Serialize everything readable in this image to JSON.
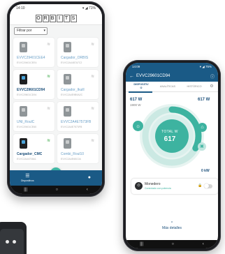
{
  "phone1": {
    "status": {
      "time": "14:10",
      "icons": "▾ ◢ 71%"
    },
    "logo_letters": [
      "O",
      "R",
      "B",
      "I",
      "T",
      "S"
    ],
    "filter": {
      "label": "Filtrar por",
      "chevron": "▾"
    },
    "devices": [
      {
        "name": "EVVC29401CEE4",
        "code": "EVVC29401CEE4",
        "wifi_on": false,
        "dark": false,
        "bold": false
      },
      {
        "name": "Cargador_ORBIS",
        "code": "EVVC2A4487A7C2",
        "wifi_on": false,
        "dark": false,
        "bold": false
      },
      {
        "name": "EVVC29601CD94",
        "code": "EVVC29601CD94",
        "wifi_on": true,
        "dark": true,
        "bold": true
      },
      {
        "name": "Cargador_Ikuill",
        "code": "EVVC2A4E9B9A2C",
        "wifi_on": false,
        "dark": false,
        "bold": false
      },
      {
        "name": "UNI_RoulC",
        "code": "EVVC29401CE60",
        "wifi_on": false,
        "dark": false,
        "bold": false
      },
      {
        "name": "EVVC2A4E7573FB",
        "code": "EVVC2A4E7573FB",
        "wifi_on": false,
        "dark": false,
        "bold": false
      },
      {
        "name": "Cargador_CMC",
        "code": "EVVC2A44705A1",
        "wifi_on": true,
        "dark": true,
        "bold": true
      },
      {
        "name": "Combi_Roul10",
        "code": "EVVC2A4E65C0A",
        "wifi_on": false,
        "dark": false,
        "bold": false
      }
    ],
    "nav": {
      "left_label": "Dispositivos",
      "left_icon": "☰",
      "fab": "+",
      "right_icon": "●"
    },
    "sysnav": [
      "|||",
      "○",
      "‹"
    ]
  },
  "phone2": {
    "status": {
      "time": "14:09",
      "icons": "▾ ◢ 75%"
    },
    "title": "EVVC29601CD94",
    "back": "←",
    "info": "ⓘ",
    "tabs": [
      "DISPOSITIV\nO",
      "ANALÍTICAS",
      "HISTÓRICO"
    ],
    "gear": "⚙",
    "energy": {
      "left_value": "617 W",
      "left_sub": "1900 W",
      "right_value": "617 W",
      "total_label": "TOTAL W",
      "total_value": "617",
      "bottom_right": "0 kW",
      "ring_fraction": 0.325,
      "sun_icon": "☼",
      "home_icon": "⌂",
      "car_icon": "▣"
    },
    "device": {
      "name": "Monedero",
      "status": "Conectado con potencia",
      "plug_icon": "⏻",
      "lock_icon": "🔒"
    },
    "more": {
      "caret": "^",
      "label": "Más detalles"
    },
    "sysnav": [
      "|||",
      "○",
      "‹"
    ]
  },
  "colors": {
    "brand_blue": "#1a5a86",
    "teal": "#3db3a0",
    "ring_bg": "#cbe9e3"
  }
}
